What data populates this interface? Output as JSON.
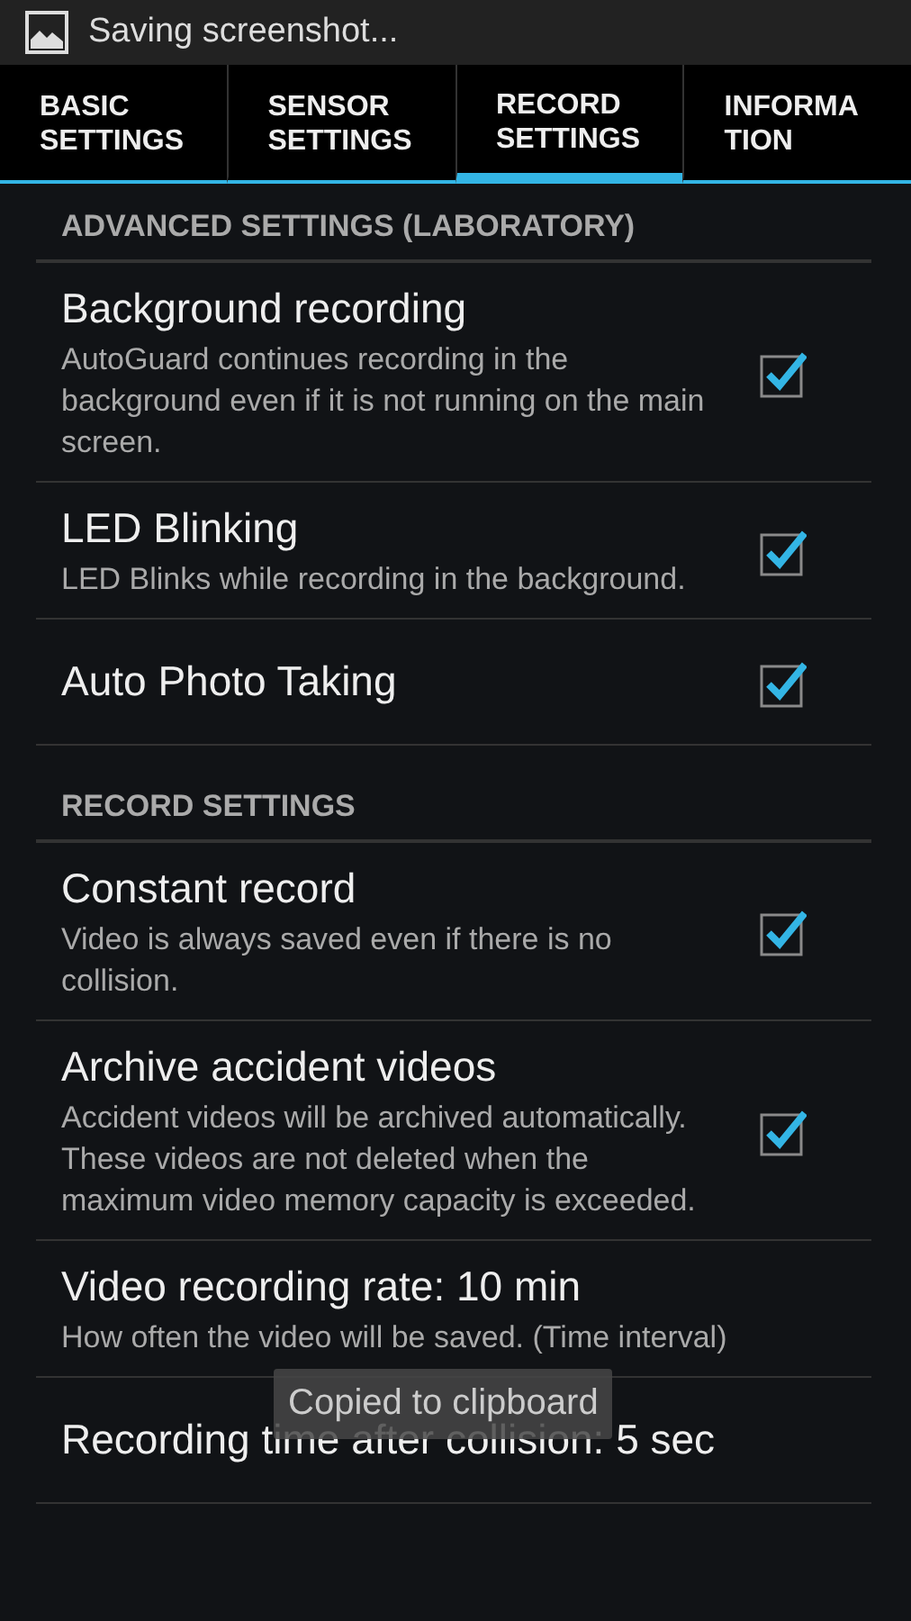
{
  "status_bar": {
    "notification": "Saving screenshot..."
  },
  "tabs": [
    {
      "label": "BASIC SETTINGS",
      "selected": false
    },
    {
      "label": "SENSOR SETTINGS",
      "selected": false
    },
    {
      "label": "RECORD SETTINGS",
      "selected": true
    },
    {
      "label": "INFORMA TION",
      "selected": false
    }
  ],
  "sections": [
    {
      "header": "ADVANCED SETTINGS (LABORATORY)",
      "items": [
        {
          "kind": "checkbox",
          "title": "Background recording",
          "summary": "AutoGuard continues recording in the background even if it is not running on the main screen.",
          "checked": true
        },
        {
          "kind": "checkbox",
          "title": "LED Blinking",
          "summary": "LED Blinks while recording in the background.",
          "checked": true
        },
        {
          "kind": "checkbox",
          "title": "Auto Photo Taking",
          "checked": true
        }
      ]
    },
    {
      "header": "RECORD SETTINGS",
      "items": [
        {
          "kind": "checkbox",
          "title": "Constant record",
          "summary": "Video is always saved even if there is no collision.",
          "checked": true
        },
        {
          "kind": "checkbox",
          "title": "Archive accident videos",
          "summary": "Accident videos will be archived automatically. These videos are not deleted when the maximum video memory capacity is exceeded.",
          "checked": true
        },
        {
          "kind": "value",
          "title": "Video recording rate: 10 min",
          "summary": "How often the video will be saved. (Time interval)"
        },
        {
          "kind": "value",
          "title": "Recording time after collision: 5 sec"
        }
      ]
    }
  ],
  "toast": "Copied to clipboard"
}
